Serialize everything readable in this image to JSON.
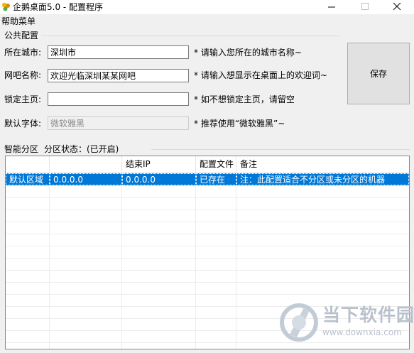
{
  "window": {
    "title": "企鹅桌面5.0 - 配置程序",
    "icon": "app-icon"
  },
  "menu": {
    "help": "帮助菜单"
  },
  "public_config": {
    "title": "公共配置",
    "fields": [
      {
        "label": "所在城市:",
        "value": "深圳市",
        "hint": "* 请输入您所在的城市名称~"
      },
      {
        "label": "网吧名称:",
        "value": "欢迎光临深圳某某网吧",
        "hint": "* 请输入想显示在桌面上的欢迎词~"
      },
      {
        "label": "锁定主页:",
        "value": "",
        "hint": "* 如不想锁定主页，请留空"
      },
      {
        "label": "默认字体:",
        "value": "微软雅黑",
        "hint": "* 推荐使用“微软雅黑”~"
      }
    ],
    "save_label": "保存"
  },
  "zones": {
    "title": "智能分区",
    "status": "分区状态：(已开启)",
    "columns": [
      "",
      "",
      "结束IP",
      "配置文件",
      "备注"
    ],
    "rows": [
      {
        "name": "默认区域",
        "start_ip": "0.0.0.0",
        "end_ip": "0.0.0.0",
        "config": "已存在",
        "note": "注：此配置适合不分区或未分区的机器"
      }
    ]
  },
  "watermark": {
    "brand": "当下软件园",
    "url": "www.downxia.com"
  },
  "colors": {
    "selection": "#0078d7",
    "window_bg": "#f0f0f0",
    "watermark": "#b9c2cc"
  }
}
